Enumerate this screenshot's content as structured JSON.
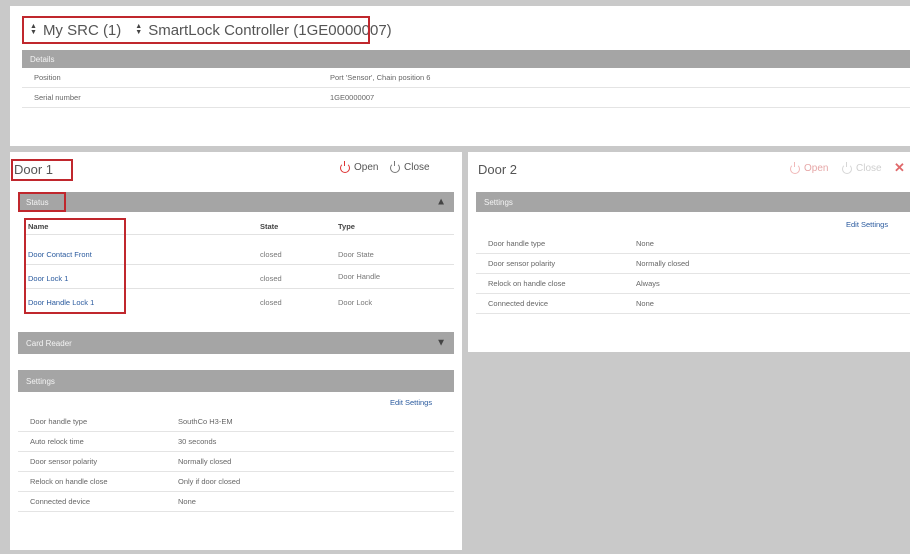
{
  "selector": {
    "src_label": "My SRC (1)",
    "controller_label": "SmartLock Controller (1GE0000007)"
  },
  "details": {
    "header": "Details",
    "rows": [
      {
        "key": "Position",
        "value": "Port 'Sensor', Chain position 6"
      },
      {
        "key": "Serial number",
        "value": "1GE0000007"
      }
    ]
  },
  "door1": {
    "title": "Door 1",
    "open_label": "Open",
    "close_label": "Close",
    "status": {
      "header": "Status",
      "columns": [
        "Name",
        "State",
        "Type"
      ],
      "rows": [
        {
          "name": "Door Contact Front",
          "state": "closed",
          "type": "Door State"
        },
        {
          "name": "Door Lock 1",
          "state": "closed",
          "type": "Door Handle"
        },
        {
          "name": "Door Handle Lock 1",
          "state": "closed",
          "type": "Door Lock"
        }
      ]
    },
    "card_reader_header": "Card Reader",
    "settings": {
      "header": "Settings",
      "edit_label": "Edit Settings",
      "rows": [
        {
          "key": "Door handle type",
          "value": "SouthCo H3-EM"
        },
        {
          "key": "Auto relock time",
          "value": "30 seconds"
        },
        {
          "key": "Door sensor polarity",
          "value": "Normally closed"
        },
        {
          "key": "Relock on handle close",
          "value": "Only if door closed"
        },
        {
          "key": "Connected device",
          "value": "None"
        }
      ]
    }
  },
  "door2": {
    "title": "Door 2",
    "open_label": "Open",
    "close_label": "Close",
    "delete_icon": "close-x-icon",
    "settings": {
      "header": "Settings",
      "edit_label": "Edit Settings",
      "rows": [
        {
          "key": "Door handle type",
          "value": "None"
        },
        {
          "key": "Door sensor polarity",
          "value": "Normally closed"
        },
        {
          "key": "Relock on handle close",
          "value": "Always"
        },
        {
          "key": "Connected device",
          "value": "None"
        }
      ]
    }
  },
  "colors": {
    "highlight": "#c0272d",
    "section_header": "#a5a5a5",
    "link": "#2a5a9e",
    "background": "#c9c9c9"
  }
}
